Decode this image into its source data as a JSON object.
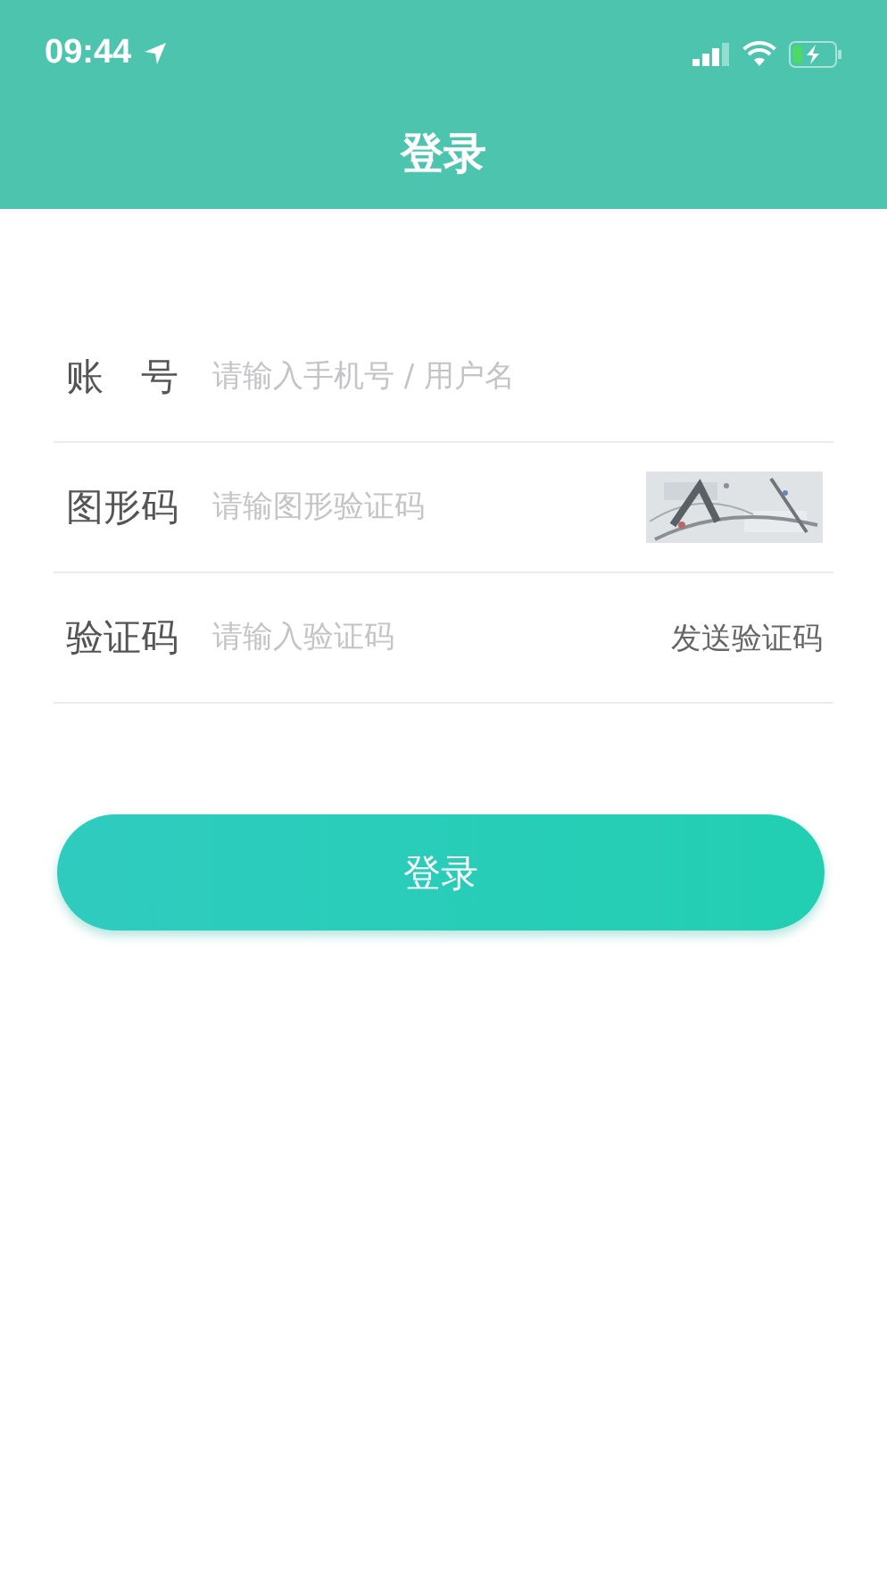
{
  "status_bar": {
    "time": "09:44"
  },
  "header": {
    "title": "登录"
  },
  "fields": [
    {
      "kind": "plain",
      "label": "账　号",
      "placeholder": "请输入手机号 / 用户名"
    },
    {
      "kind": "captcha",
      "label": "图形码",
      "placeholder": "请输图形验证码"
    },
    {
      "kind": "sms",
      "label": "验证码",
      "placeholder": "请输入验证码",
      "action": "发送验证码"
    }
  ],
  "submit": {
    "label": "登录"
  }
}
